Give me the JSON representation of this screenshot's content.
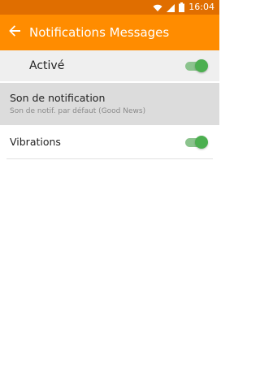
{
  "status_bar": {
    "time": "16:04",
    "icons": [
      "wifi-icon",
      "signal-icon",
      "battery-icon"
    ]
  },
  "app_bar": {
    "title": "Notifications Messages",
    "back_icon": "arrow-left-icon"
  },
  "master_switch": {
    "label": "Activé",
    "enabled": true
  },
  "settings": {
    "sound": {
      "title": "Son de notification",
      "subtitle": "Son de notif. par défaut (Good News)"
    },
    "vibrations": {
      "label": "Vibrations",
      "enabled": true
    }
  },
  "colors": {
    "accent": "#ff8c00",
    "status_bar": "#e06e00",
    "toggle_on": "#4caf50",
    "toggle_track": "#8bc38d"
  }
}
